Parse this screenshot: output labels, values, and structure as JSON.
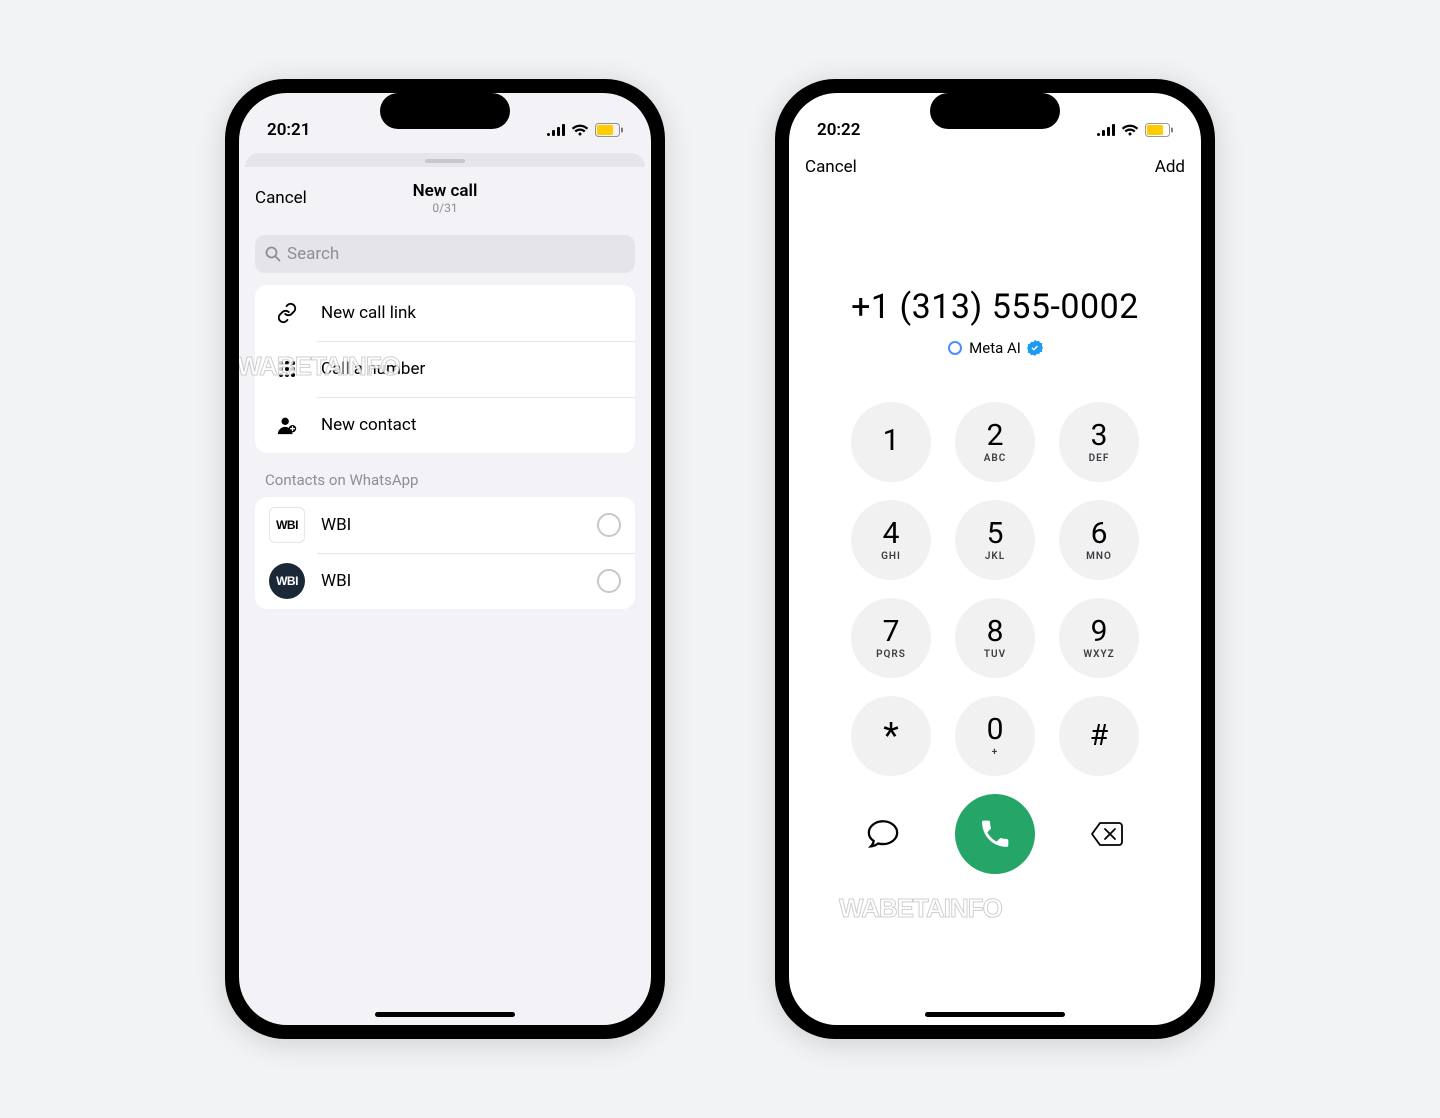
{
  "left": {
    "status_time": "20:21",
    "header": {
      "cancel": "Cancel",
      "title": "New call",
      "subtitle": "0/31"
    },
    "search_placeholder": "Search",
    "actions": {
      "new_call_link": "New call link",
      "call_a_number": "Call a number",
      "new_contact": "New contact"
    },
    "contacts_section_label": "Contacts on WhatsApp",
    "contacts": [
      {
        "avatar": "WBI",
        "name": "WBI",
        "style": "light"
      },
      {
        "avatar": "WBI",
        "name": "WBI",
        "style": "dark"
      }
    ]
  },
  "right": {
    "status_time": "20:22",
    "header": {
      "cancel": "Cancel",
      "add": "Add"
    },
    "dialed_number": "+1 (313) 555-0002",
    "caller_id_name": "Meta AI",
    "keypad": [
      {
        "digit": "1",
        "letters": " "
      },
      {
        "digit": "2",
        "letters": "ABC"
      },
      {
        "digit": "3",
        "letters": "DEF"
      },
      {
        "digit": "4",
        "letters": "GHI"
      },
      {
        "digit": "5",
        "letters": "JKL"
      },
      {
        "digit": "6",
        "letters": "MNO"
      },
      {
        "digit": "7",
        "letters": "PQRS"
      },
      {
        "digit": "8",
        "letters": "TUV"
      },
      {
        "digit": "9",
        "letters": "WXYZ"
      },
      {
        "digit": "*",
        "letters": ""
      },
      {
        "digit": "0",
        "letters": "+"
      },
      {
        "digit": "#",
        "letters": ""
      }
    ]
  },
  "watermark": "WABETAINFO",
  "colors": {
    "call_green": "#25a567",
    "battery_yellow": "#ffcc00"
  }
}
